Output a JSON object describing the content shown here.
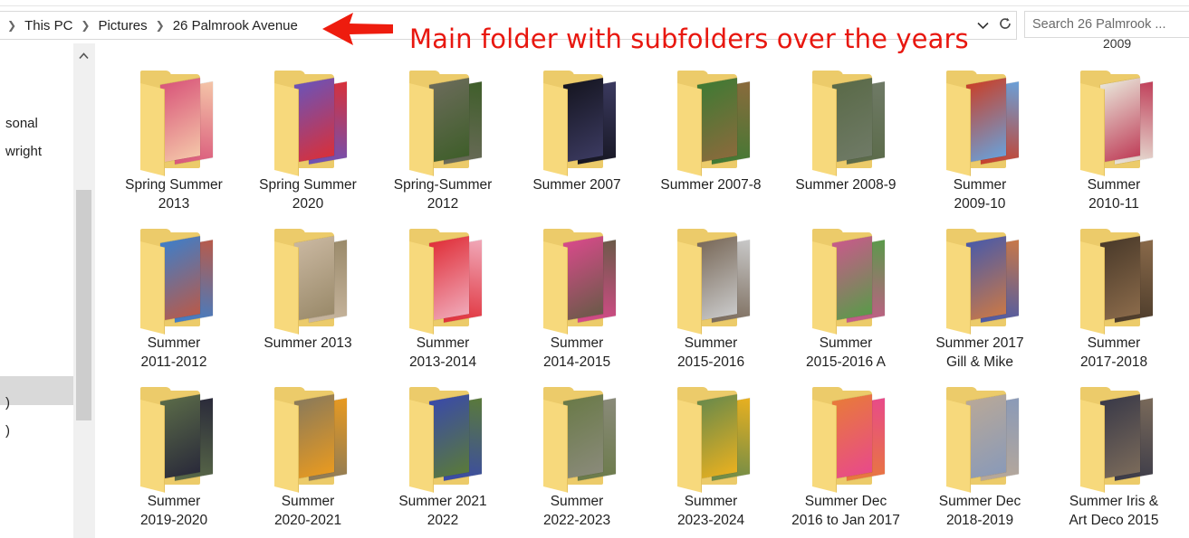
{
  "breadcrumb": {
    "items": [
      "This PC",
      "Pictures",
      "26 Palmrook Avenue"
    ]
  },
  "address_controls": {
    "dropdown_icon": "chevron-down-icon",
    "refresh_icon": "refresh-icon"
  },
  "search": {
    "placeholder": "Search 26 Palmrook ..."
  },
  "annotation": {
    "text": "Main folder with subfolders over the years",
    "color": "#e8170f"
  },
  "nav_pane": {
    "items": [
      "sonal",
      "wright",
      ")",
      ")"
    ],
    "scroll_up_icon": "chevron-up-icon"
  },
  "partial_label_top": "2009",
  "folders": [
    {
      "line1": "Spring Summer",
      "line2": "2013",
      "colors": [
        "#d9567a",
        "#f4c5a8"
      ]
    },
    {
      "line1": "Spring Summer",
      "line2": "2020",
      "colors": [
        "#6b53b8",
        "#d8303a"
      ]
    },
    {
      "line1": "Spring-Summer",
      "line2": "2012",
      "colors": [
        "#6b6b5a",
        "#3f5e2a"
      ]
    },
    {
      "line1": "Summer 2007",
      "line2": "",
      "colors": [
        "#151520",
        "#3b3a60"
      ]
    },
    {
      "line1": "Summer 2007-8",
      "line2": "",
      "colors": [
        "#3f7a34",
        "#8b6a3c"
      ]
    },
    {
      "line1": "Summer 2008-9",
      "line2": "",
      "colors": [
        "#5a6a48",
        "#6f7a66"
      ]
    },
    {
      "line1": "Summer",
      "line2": "2009-10",
      "colors": [
        "#c8402a",
        "#6aa0d8"
      ]
    },
    {
      "line1": "Summer",
      "line2": "2010-11",
      "colors": [
        "#e8e4d8",
        "#c0405a"
      ]
    },
    {
      "line1": "Summer",
      "line2": "2011-2012",
      "colors": [
        "#3f7ec8",
        "#b85a4a"
      ]
    },
    {
      "line1": "Summer 2013",
      "line2": "",
      "colors": [
        "#c9b7a0",
        "#9a8a6a"
      ]
    },
    {
      "line1": "Summer",
      "line2": "2013-2014",
      "colors": [
        "#e0303a",
        "#f0a8b8"
      ]
    },
    {
      "line1": "Summer",
      "line2": "2014-2015",
      "colors": [
        "#d84a8a",
        "#6a5a48"
      ]
    },
    {
      "line1": "Summer",
      "line2": "2015-2016",
      "colors": [
        "#7a6a5a",
        "#c8c8c8"
      ]
    },
    {
      "line1": "Summer",
      "line2": "2015-2016 A",
      "colors": [
        "#c85a8a",
        "#5a9a4a"
      ]
    },
    {
      "line1": "Summer 2017",
      "line2": "Gill & Mike",
      "colors": [
        "#4a5aa8",
        "#c87848"
      ]
    },
    {
      "line1": "Summer",
      "line2": "2017-2018",
      "colors": [
        "#4a3a2a",
        "#8a6a4a"
      ]
    },
    {
      "line1": "Summer",
      "line2": "2019-2020",
      "colors": [
        "#5a6a48",
        "#2a2a3a"
      ]
    },
    {
      "line1": "Summer",
      "line2": "2020-2021",
      "colors": [
        "#8a7a5a",
        "#e89a20"
      ]
    },
    {
      "line1": "Summer 2021",
      "line2": "2022",
      "colors": [
        "#3a4aa8",
        "#5a7a3a"
      ]
    },
    {
      "line1": "Summer",
      "line2": "2022-2023",
      "colors": [
        "#6a7a48",
        "#8a8a7a"
      ]
    },
    {
      "line1": "Summer",
      "line2": "2023-2024",
      "colors": [
        "#6a8a4a",
        "#e8b020"
      ]
    },
    {
      "line1": "Summer Dec",
      "line2": "2016 to Jan 2017",
      "colors": [
        "#e87a3a",
        "#e84a8a"
      ]
    },
    {
      "line1": "Summer Dec",
      "line2": "2018-2019",
      "colors": [
        "#b8a898",
        "#8a9ab8"
      ]
    },
    {
      "line1": "Summer Iris &",
      "line2": "Art Deco 2015",
      "colors": [
        "#3a3a48",
        "#7a6a5a"
      ]
    }
  ]
}
